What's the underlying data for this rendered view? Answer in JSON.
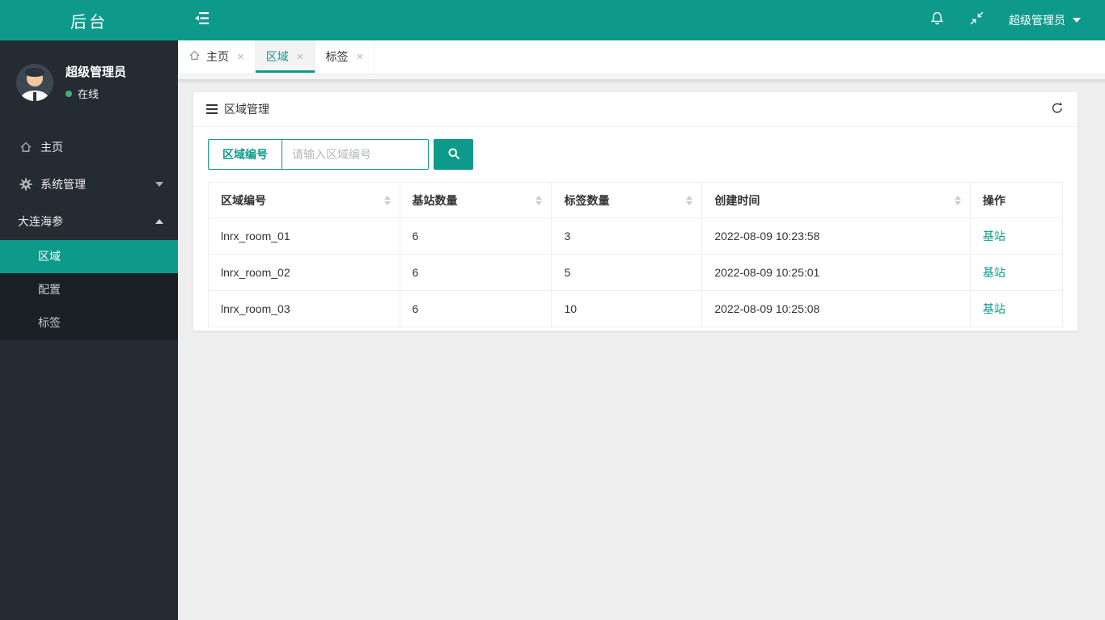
{
  "colors": {
    "accent": "#0d9a8a",
    "sidebar_bg": "#252b32",
    "submenu_bg": "#1a1f25",
    "online_green": "#3cb371",
    "content_bg": "#efefef",
    "link": "#0d9a8a"
  },
  "icons": {
    "close_glyph": "×",
    "names": [
      "menu-fold-icon",
      "bell-icon",
      "exit-fullscreen-icon",
      "caret-down-icon",
      "caret-up-icon",
      "home-icon",
      "gear-icon",
      "list-icon",
      "refresh-icon",
      "search-icon",
      "sort-icon",
      "online-dot"
    ]
  },
  "topbar": {
    "logo": "后台",
    "username": "超级管理员"
  },
  "sidebar": {
    "user": {
      "name": "超级管理员",
      "status": "在线"
    },
    "menu": [
      {
        "label": "主页",
        "icon": "home-icon"
      },
      {
        "label": "系统管理",
        "icon": "gear-icon",
        "caret": "down"
      },
      {
        "label": "大连海参",
        "caret": "up",
        "expanded": true
      }
    ],
    "submenu": [
      {
        "label": "区域",
        "active": true
      },
      {
        "label": "配置",
        "active": false
      },
      {
        "label": "标签",
        "active": false
      }
    ]
  },
  "tabs": [
    {
      "label": "主页",
      "icon": "home-icon",
      "active": false
    },
    {
      "label": "区域",
      "active": true
    },
    {
      "label": "标签",
      "active": false
    }
  ],
  "panel": {
    "title": "区域管理"
  },
  "search": {
    "field_label": "区域编号",
    "placeholder": "请输入区域编号",
    "value": ""
  },
  "table": {
    "columns": [
      "区域编号",
      "基站数量",
      "标签数量",
      "创建时间",
      "操作"
    ],
    "sortable": [
      true,
      true,
      true,
      true,
      false
    ],
    "rows": [
      {
        "cells": [
          "lnrx_room_01",
          "6",
          "3",
          "2022-08-09 10:23:58"
        ],
        "action": "基站"
      },
      {
        "cells": [
          "lnrx_room_02",
          "6",
          "5",
          "2022-08-09 10:25:01"
        ],
        "action": "基站"
      },
      {
        "cells": [
          "lnrx_room_03",
          "6",
          "10",
          "2022-08-09 10:25:08"
        ],
        "action": "基站"
      }
    ]
  }
}
